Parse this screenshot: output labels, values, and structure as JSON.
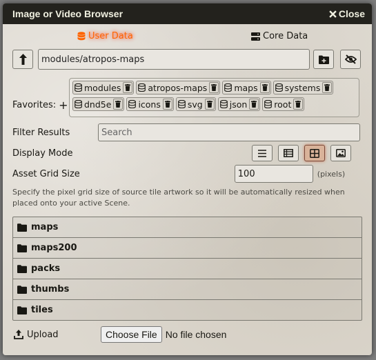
{
  "window": {
    "title": "Image or Video Browser",
    "close_label": "Close"
  },
  "tabs": [
    {
      "label": "User Data",
      "active": true
    },
    {
      "label": "Core Data",
      "active": false
    }
  ],
  "path": {
    "value": "modules/atropos-maps"
  },
  "favorites": {
    "label": "Favorites:",
    "items": [
      "modules",
      "atropos-maps",
      "maps",
      "systems",
      "dnd5e",
      "icons",
      "svg",
      "json",
      "root"
    ]
  },
  "filter": {
    "label": "Filter Results",
    "placeholder": "Search"
  },
  "display_mode": {
    "label": "Display Mode",
    "active": "tiles"
  },
  "grid_size": {
    "label": "Asset Grid Size",
    "value": "100",
    "units": "(pixels)",
    "hint": "Specify the pixel grid size of source tile artwork so it will be automatically resized when placed onto your active Scene."
  },
  "directories": [
    "maps",
    "maps200",
    "packs",
    "thumbs",
    "tiles"
  ],
  "upload": {
    "label": "Upload",
    "choose_label": "Choose File",
    "status": "No file chosen"
  },
  "colors": {
    "accent": "#ff6400",
    "titlebar": "#23221d"
  }
}
